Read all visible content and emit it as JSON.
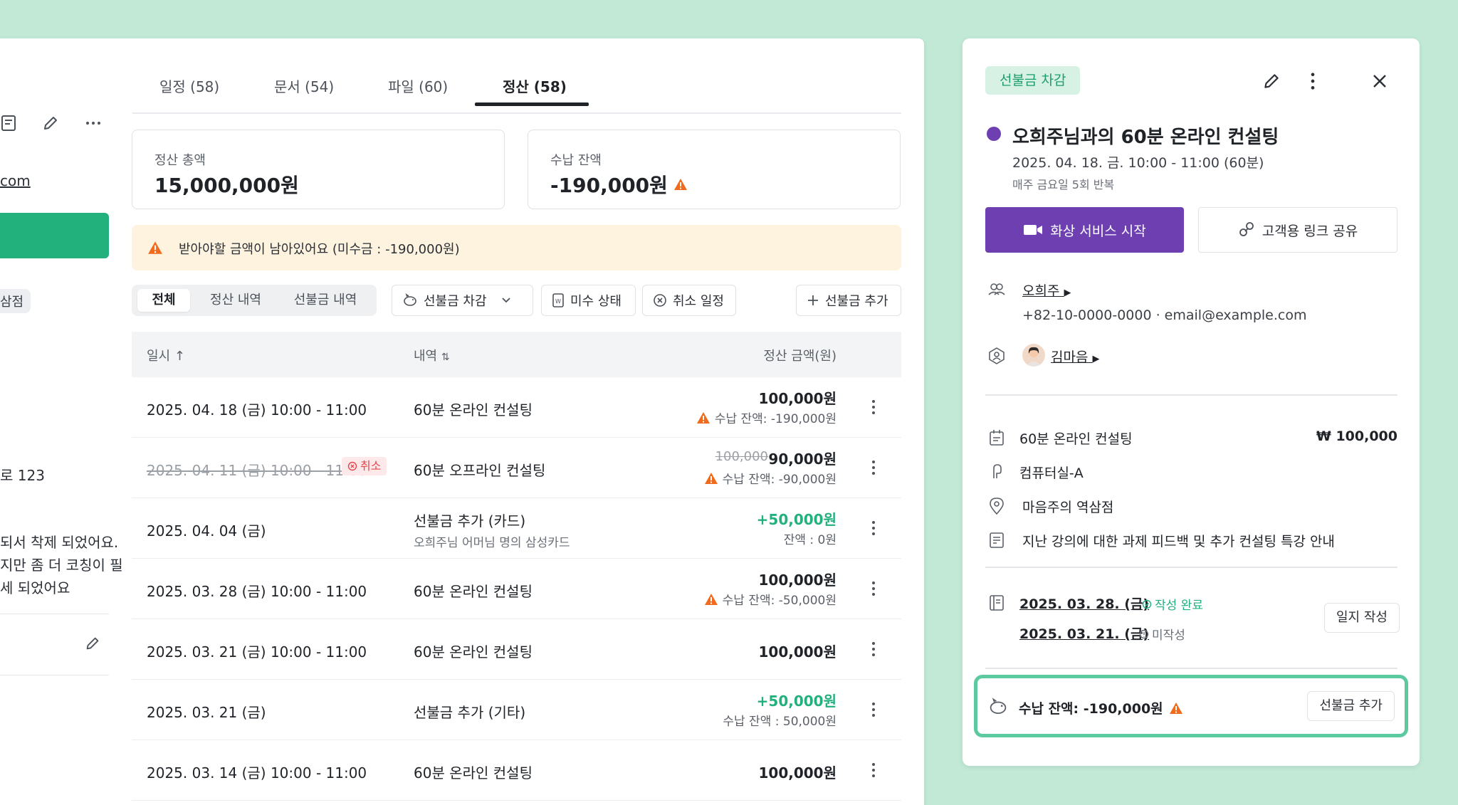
{
  "left_panel": {
    "email_fragment": "com",
    "chip_fragment": "삼점",
    "address_fragment": "로 123",
    "note_lines": [
      "되서 착제 되었어요.",
      "지만 좀 더 코칭이 필",
      "세 되었어요"
    ]
  },
  "tabs": [
    {
      "label": "일정 (58)"
    },
    {
      "label": "문서 (54)"
    },
    {
      "label": "파일 (60)"
    },
    {
      "label": "정산 (58)"
    }
  ],
  "summary": {
    "total_label": "정산 총액",
    "total_value": "15,000,000원",
    "balance_label": "수납 잔액",
    "balance_value": "-190,000원"
  },
  "warning_banner": "받아야할 금액이 남아있어요 (미수금 : -190,000원)",
  "segments": [
    "전체",
    "정산 내역",
    "선불금 내역"
  ],
  "filters": {
    "prepay_deduct": "선불금 차감",
    "unpaid_status": "미수 상태",
    "cancelled": "취소 일정",
    "add_prepay": "선불금 추가"
  },
  "table": {
    "col_date": "일시",
    "col_desc": "내역",
    "col_amount": "정산 금액(원)",
    "rows": [
      {
        "date": "2025. 04. 18 (금) 10:00 - 11:00",
        "desc": "60분 온라인 컨설팅",
        "amount": "100,000원",
        "sub": "수납 잔액:  -190,000원"
      },
      {
        "date": "2025. 04. 11 (금) 10:00 - 11:00",
        "badge": "취소",
        "desc": "60분 오프라인 컨설팅",
        "old_amount": "100,000",
        "amount": "90,000원",
        "sub": "수납 잔액: -90,000원"
      },
      {
        "date": "2025. 04. 04 (금)",
        "desc": "선불금 추가 (카드)",
        "desc_sub": "오희주님 어머님 명의 삼성카드",
        "amount": "+50,000원",
        "sub": "잔액 : 0원"
      },
      {
        "date": "2025. 03. 28 (금) 10:00 - 11:00",
        "desc": "60분 온라인 컨설팅",
        "amount": "100,000원",
        "sub": "수납 잔액: -50,000원"
      },
      {
        "date": "2025. 03. 21 (금) 10:00 - 11:00",
        "desc": "60분 온라인 컨설팅",
        "amount": "100,000원"
      },
      {
        "date": "2025. 03. 21 (금)",
        "desc": "선불금 추가 (기타)",
        "amount": "+50,000원",
        "sub": "수납 잔액 : 50,000원"
      },
      {
        "date": "2025. 03. 14 (금) 10:00 - 11:00",
        "desc": "60분 온라인 컨설팅",
        "amount": "100,000원"
      }
    ]
  },
  "side": {
    "badge": "선불금 차감",
    "title": "오희주님과의 60분 온라인 컨설팅",
    "datetime": "2025. 04. 18. 금. 10:00 - 11:00 (60분)",
    "repeat": "매주 금요일 5회 반복",
    "video_button": "화상 서비스 시작",
    "share_button": "고객용 링크 공유",
    "client_name": "오희주",
    "client_contact": "+82-10-0000-0000 · email@example.com",
    "staff_name": "김마음",
    "service": "60분 온라인 컨설팅",
    "price": "₩ 100,000",
    "room": "컴퓨터실-A",
    "place": "마음주의 역삼점",
    "memo": "지난 강의에 대한 과제 피드백 및 추가 컨설팅 특강 안내",
    "log1_date": "2025. 03. 28. (금)",
    "log1_status": "작성 완료",
    "log2_date": "2025. 03. 21. (금)",
    "log2_status": "미작성",
    "log_button": "일지 작성",
    "balance_text": "수납 잔액: -190,000원",
    "add_prepay_button": "선불금 추가"
  },
  "colors": {
    "background": "#c2e8d6",
    "brand_green": "#22b07d",
    "purple": "#6e3fb0",
    "warning_orange": "#f26b1d"
  }
}
